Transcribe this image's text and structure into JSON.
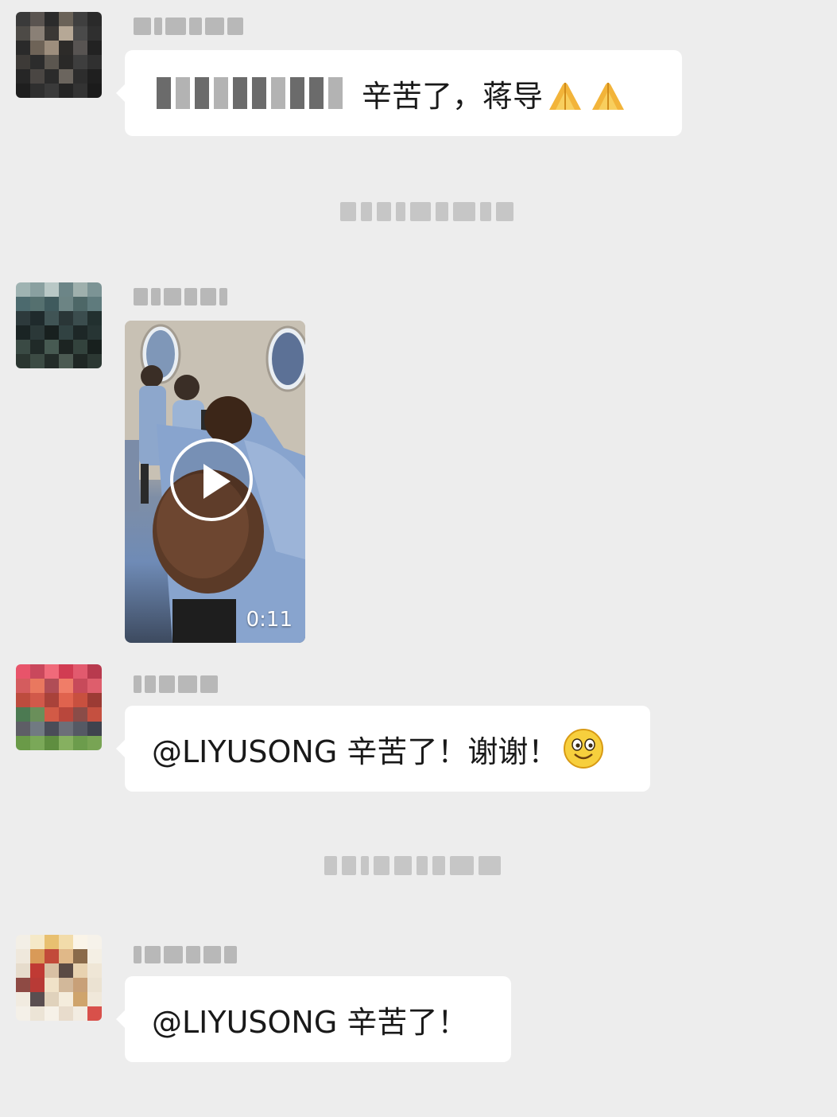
{
  "messages": [
    {
      "type": "text",
      "text": "辛苦了，蒋导",
      "emoji": [
        "folded-hands-icon",
        "folded-hands-icon"
      ]
    },
    {
      "type": "video",
      "duration": "0:11"
    },
    {
      "type": "text",
      "text": "@LIYUSONG 辛苦了！谢谢！",
      "emoji": [
        "smile-icon"
      ]
    },
    {
      "type": "text",
      "text": "@LIYUSONG 辛苦了！"
    }
  ],
  "colors": {
    "background": "#ededed",
    "bubble": "#ffffff",
    "text": "#191919"
  }
}
